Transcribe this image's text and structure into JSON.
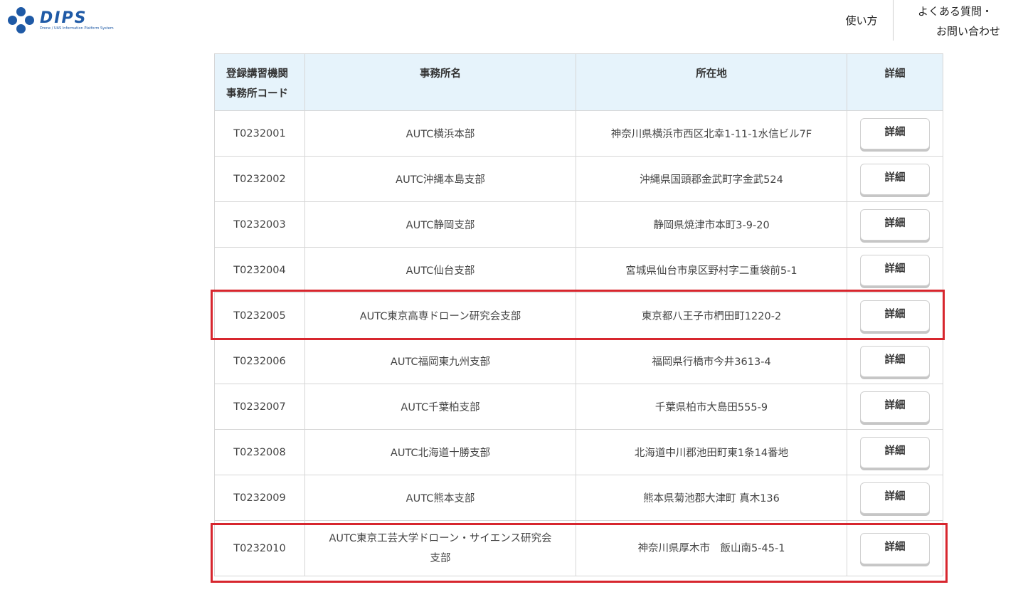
{
  "header": {
    "logo_text": "DIPS",
    "logo_subtext": "Drone / UAS Information Platform System",
    "nav_howto": "使い方",
    "nav_faq_line1": "よくある質問・",
    "nav_faq_line2": "お問い合わせ"
  },
  "table": {
    "headers": {
      "code_line1": "登録講習機関",
      "code_line2": "事務所コード",
      "name": "事務所名",
      "address": "所在地",
      "detail": "詳細"
    },
    "rows": [
      {
        "code": "T0232001",
        "name": "AUTC横浜本部",
        "address": "神奈川県横浜市西区北幸1-11-1水信ビル7F",
        "button": "詳細"
      },
      {
        "code": "T0232002",
        "name": "AUTC沖縄本島支部",
        "address": "沖縄県国頭郡金武町字金武524",
        "button": "詳細"
      },
      {
        "code": "T0232003",
        "name": "AUTC静岡支部",
        "address": "静岡県焼津市本町3-9-20",
        "button": "詳細"
      },
      {
        "code": "T0232004",
        "name": "AUTC仙台支部",
        "address": "宮城県仙台市泉区野村字二重袋前5-1",
        "button": "詳細"
      },
      {
        "code": "T0232005",
        "name": "AUTC東京高専ドローン研究会支部",
        "address": "東京都八王子市椚田町1220-2",
        "button": "詳細"
      },
      {
        "code": "T0232006",
        "name": "AUTC福岡東九州支部",
        "address": "福岡県行橋市今井3613-4",
        "button": "詳細"
      },
      {
        "code": "T0232007",
        "name": "AUTC千葉柏支部",
        "address": "千葉県柏市大島田555-9",
        "button": "詳細"
      },
      {
        "code": "T0232008",
        "name": "AUTC北海道十勝支部",
        "address": "北海道中川郡池田町東1条14番地",
        "button": "詳細"
      },
      {
        "code": "T0232009",
        "name": "AUTC熊本支部",
        "address": "熊本県菊池郡大津町 真木136",
        "button": "詳細"
      },
      {
        "code": "T0232010",
        "name_line1": "AUTC東京工芸大学ドローン・サイエンス研究会",
        "name_line2": "支部",
        "address": "神奈川県厚木市　飯山南5-45-1",
        "button": "詳細"
      }
    ]
  },
  "colors": {
    "brand": "#1f5aa6",
    "header_bg": "#e6f3fb",
    "highlight": "#d7262e"
  }
}
